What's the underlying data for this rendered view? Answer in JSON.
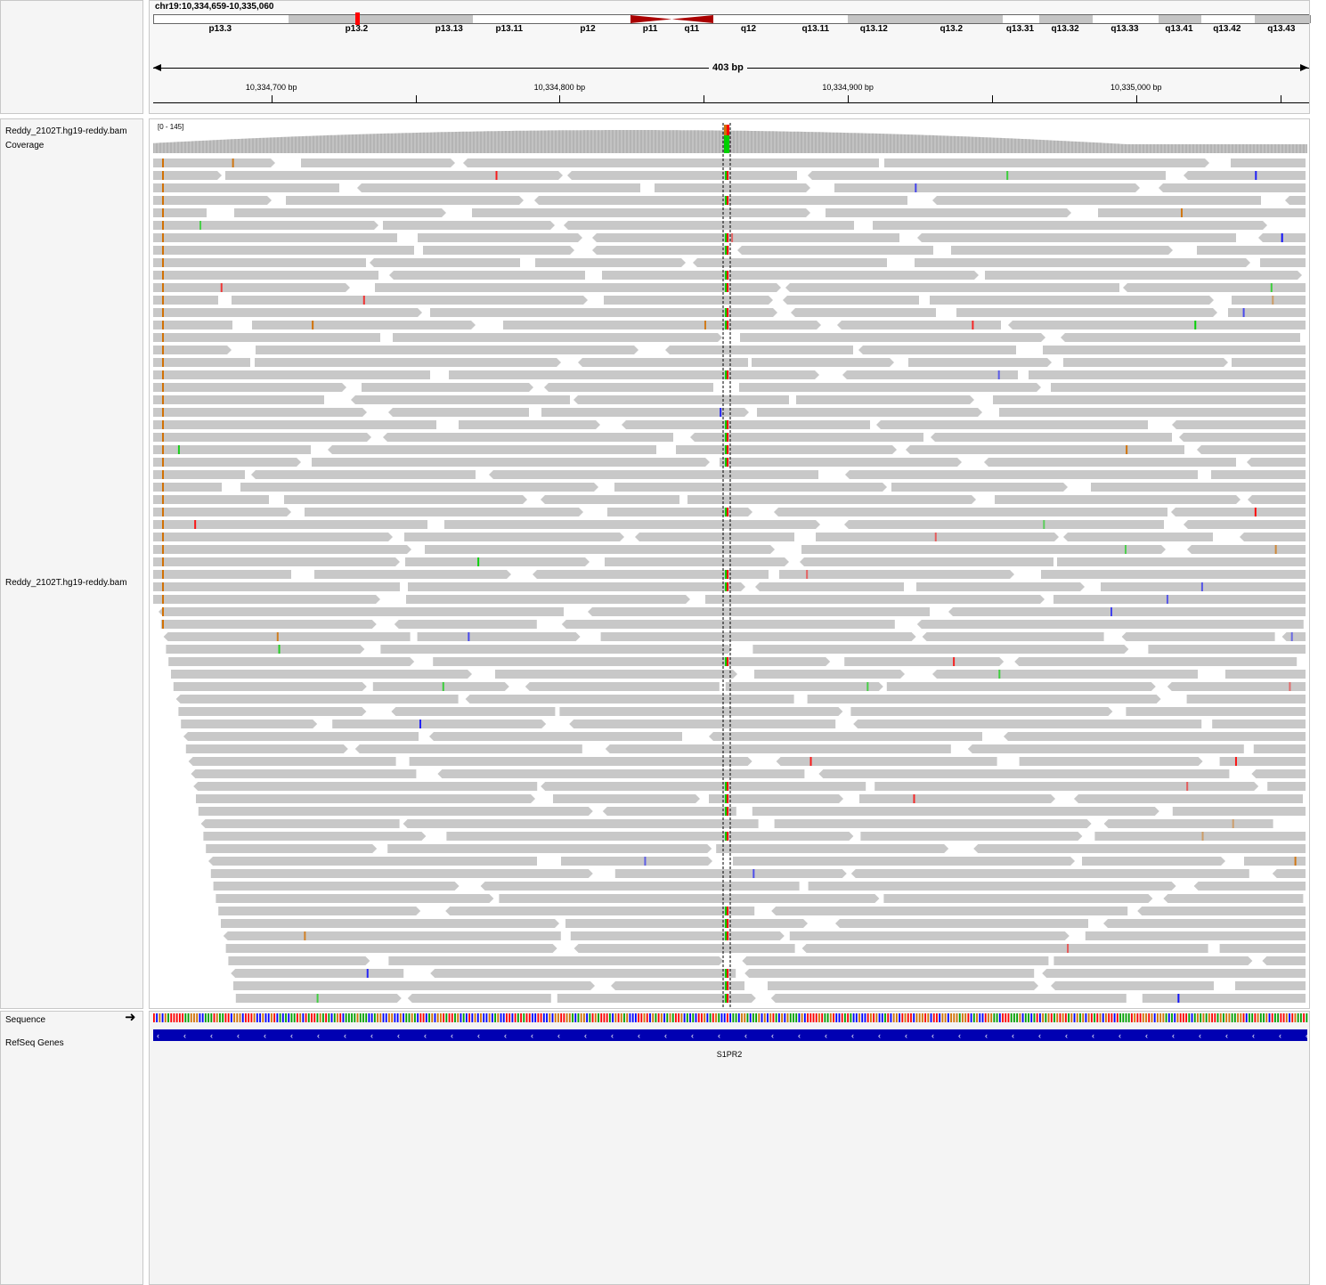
{
  "locus": "chr19:10,334,659-10,335,060",
  "span_label": "403 bp",
  "cytobands": [
    {
      "name": "p13.3",
      "start": 0,
      "end": 0.116,
      "stain": "white"
    },
    {
      "name": "p13.2",
      "start": 0.116,
      "end": 0.236,
      "stain": "gray",
      "marker": true
    },
    {
      "name": "p13.13",
      "start": 0.236,
      "end": 0.276,
      "stain": "gray"
    },
    {
      "name": "p13.11",
      "start": 0.276,
      "end": 0.34,
      "stain": "white"
    },
    {
      "name": "p12",
      "start": 0.34,
      "end": 0.412,
      "stain": "white"
    },
    {
      "name": "p11",
      "start": 0.412,
      "end": 0.448,
      "stain": "acen-left"
    },
    {
      "name": "q11",
      "start": 0.448,
      "end": 0.484,
      "stain": "acen-right"
    },
    {
      "name": "q12",
      "start": 0.484,
      "end": 0.546,
      "stain": "white"
    },
    {
      "name": "q13.11",
      "start": 0.546,
      "end": 0.6,
      "stain": "white"
    },
    {
      "name": "q13.12",
      "start": 0.6,
      "end": 0.647,
      "stain": "gray"
    },
    {
      "name": "q13.2",
      "start": 0.647,
      "end": 0.734,
      "stain": "gray"
    },
    {
      "name": "q13.31",
      "start": 0.734,
      "end": 0.766,
      "stain": "white"
    },
    {
      "name": "q13.32",
      "start": 0.766,
      "end": 0.812,
      "stain": "gray"
    },
    {
      "name": "q13.33",
      "start": 0.812,
      "end": 0.869,
      "stain": "white"
    },
    {
      "name": "q13.41",
      "start": 0.869,
      "end": 0.906,
      "stain": "gray"
    },
    {
      "name": "q13.42",
      "start": 0.906,
      "end": 0.952,
      "stain": "white"
    },
    {
      "name": "q13.43",
      "start": 0.952,
      "end": 1,
      "stain": "gray"
    }
  ],
  "ruler_ticks": [
    {
      "label": "10,334,700 bp",
      "pos": 10334700
    },
    {
      "label": "10,334,800 bp",
      "pos": 10334800
    },
    {
      "label": "10,334,900 bp",
      "pos": 10334900
    },
    {
      "label": "10,335,000 bp",
      "pos": 10335000
    }
  ],
  "view_start": 10334659,
  "view_end": 10335060,
  "tracks": {
    "coverage_name": "Reddy_2102T.hg19-reddy.bam Coverage",
    "coverage_range": "[0 - 145]",
    "alignment_name": "Reddy_2102T.hg19-reddy.bam",
    "sequence_name": "Sequence",
    "refseq_name": "RefSeq Genes"
  },
  "gene": {
    "name": "S1PR2",
    "strand": "-"
  },
  "colors": {
    "read": "#c8c8c8",
    "coverage": "#b4b4b4",
    "gene": "#0000b2",
    "mismatch_A": "#00d100",
    "mismatch_C": "#0000ff",
    "mismatch_G": "#d17105",
    "mismatch_T": "#ff0000",
    "centromere": "#aa0000"
  },
  "sequence_icon": "right-arrow-icon"
}
